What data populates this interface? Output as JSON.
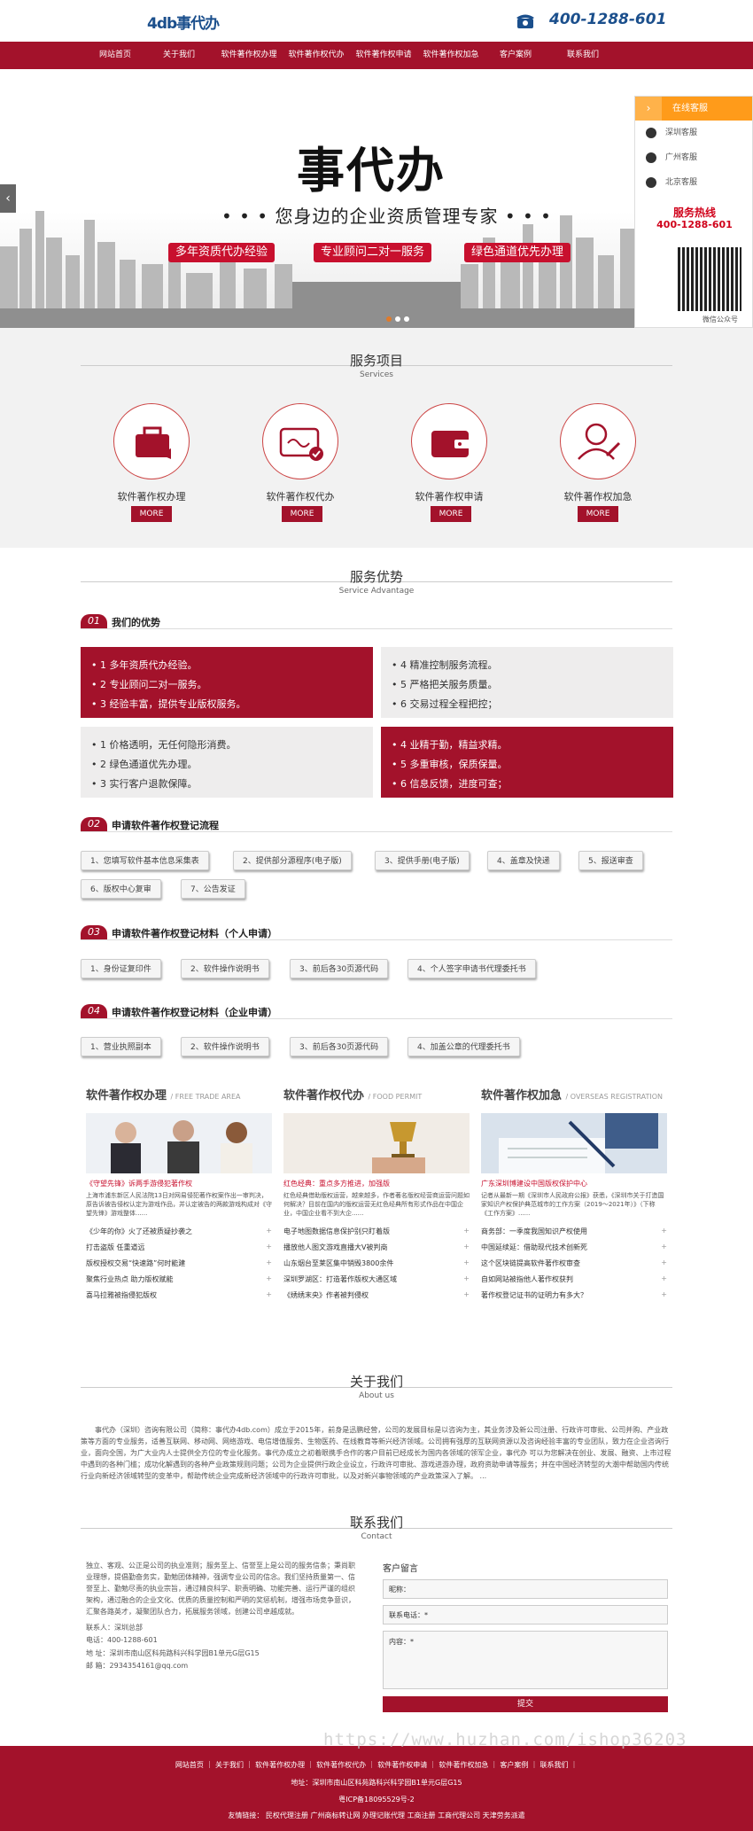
{
  "header": {
    "logo_mark": "4db",
    "logo_text": "事代办",
    "phone": "400-1288-601"
  },
  "nav": [
    "网站首页",
    "关于我们",
    "软件著作权办理",
    "软件著作权代办",
    "软件著作权申请",
    "软件著作权加急",
    "客户案例",
    "联系我们"
  ],
  "banner": {
    "brand": "事代办",
    "slogan": "• • •  您身边的企业资质管理专家  • • •",
    "tags": [
      "多年资质代办经验",
      "专业顾问二对一服务",
      "绿色通道优先办理"
    ]
  },
  "side": {
    "title": "在线客服",
    "items": [
      "深圳客服",
      "广州客服",
      "北京客服"
    ],
    "hotline_label": "服务热线",
    "hotline": "400-1288-601",
    "qr_caption": "微信公众号"
  },
  "services": {
    "title": "服务项目",
    "subtitle": "Services",
    "items": [
      {
        "label": "软件著作权办理"
      },
      {
        "label": "软件著作权代办"
      },
      {
        "label": "软件著作权申请"
      },
      {
        "label": "软件著作权加急"
      }
    ],
    "more": "MORE"
  },
  "advantage": {
    "title": "服务优势",
    "subtitle": "Service Advantage",
    "h1_num": "01",
    "h1": "我们的优势",
    "box1": [
      "• 1 多年资质代办经验。",
      "• 2 专业顾问二对一服务。",
      "• 3 经验丰富，提供专业版权服务。"
    ],
    "box2": [
      "• 4 精准控制服务流程。",
      "• 5 严格把关服务质量。",
      "• 6 交易过程全程把控；"
    ],
    "box3": [
      "• 1 价格透明，无任何隐形消费。",
      "• 2 绿色通道优先办理。",
      "• 3 实行客户退款保障。"
    ],
    "box4": [
      "• 4 业精于勤，精益求精。",
      "• 5 多重审核，保质保量。",
      "• 6 信息反馈，进度可查；"
    ],
    "h2_num": "02",
    "h2": "申请软件著作权登记流程",
    "steps": [
      "1、您填写软件基本信息采集表",
      "2、提供部分源程序(电子版)",
      "3、提供手册(电子版)",
      "4、盖章及快递",
      "5、报送审查",
      "6、版权中心复审",
      "7、公告发证"
    ],
    "h3_num": "03",
    "h3": "申请软件著作权登记材料（个人申请）",
    "personal": [
      "1、身份证复印件",
      "2、软件操作说明书",
      "3、前后各30页源代码",
      "4、个人签字申请书代理委托书"
    ],
    "h4_num": "04",
    "h4": "申请软件著作权登记材料（企业申请）",
    "company": [
      "1、营业执照副本",
      "2、软件操作说明书",
      "3、前后各30页源代码",
      "4、加盖公章的代理委托书"
    ]
  },
  "columns": [
    {
      "title": "软件著作权办理",
      "sub": "/ FREE TRADE AREA",
      "headline": "《守望先锋》诉两手游侵犯著作权",
      "summary": "上海市浦东新区人民法院13日对网易侵犯著作权案作出一审判决，原告诉被告侵权认定为游戏作品，并认定被告的两款游戏构成对《守望先锋》游戏整体......",
      "items": [
        "《少年的你》火了还被质疑抄袭之",
        "打击盗版 任重道远",
        "版权授权交易“快速路”何时能建",
        "聚焦行业热点 助力版权赋能",
        "喜马拉雅被指侵犯版权"
      ]
    },
    {
      "title": "软件著作权代办",
      "sub": "/ FOOD PERMIT",
      "headline": "红色经典：重点多方推进，加强版",
      "summary": "红色经典借助版权运营，越来越多，作者著名版权经营商运营问题如何解决？目前在国内的版权运营无红色经典所有形式作品在中国企业，中国企业看不到大企......",
      "items": [
        "电子地图数据信息保护别只盯着版",
        "播放他人图文游戏直播大V被判商",
        "山东烟台至莱区集中销毁3800余件",
        "深圳罗湖区：打造著作版权大通区域",
        "《绣绣末央》作者被判侵权"
      ]
    },
    {
      "title": "软件著作权加急",
      "sub": "/ OVERSEAS REGISTRATION",
      "headline": "广东深圳博建设中国版权保护中心",
      "summary": "记者从最新一期《深圳市人民政府公报》获悉，《深圳市关于打造国家知识产权保护典范城市的工作方案（2019～2021年）》（下称《工作方案》......",
      "items": [
        "商务部：一季度我国知识产权使用",
        "中国延续延：借助现代技术创新死",
        "这个区块链提高软件著作权审查",
        "自如网站被指他人著作权获判",
        "著作权登记证书的证明力有多大？"
      ]
    }
  ],
  "about": {
    "title": "关于我们",
    "subtitle": "About us",
    "text": "事代办（深圳）咨询有限公司（简称：事代办4db.com）成立于2015年，前身是迅鹏经营，公司的发展目标是以咨询为主，其业务涉及新公司注册、行政许可审批、公司并购、产业政策等方面的专业服务，适善互联网、移动网、网络游戏、电信增值服务、生物医药、在线教育等新兴经济领域。公司拥有强厚的互联网资源以及咨询经验丰富的专业团队，致力在企业咨询行业，面向全国，为广大业内人士提供全方位的专业化服务。事代办成立之初着眼携手合作的客户目前已经成长为国内各领域的领军企业，事代办 可以为您解决在创业、发展、融资、上市过程中遇到的各种门槛；成功化解遇到的各种产业政策规则问题；公司为企业提供行政企业设立，行政许可审批、游戏进游办理，政府资助申请等服务；并在中国经济转型的大潮中帮助国内传统行业向新经济领域转型的变革中，帮助传统企业完成新经济领域中的行政许可审批，以及对新兴事物领域的产业政策深入了解。 ..."
  },
  "contact": {
    "title": "联系我们",
    "subtitle": "Contact",
    "text": "独立、客观、公正是公司的执业准则；服务至上、信誉至上是公司的服务信条；秉尚职业理想，提倡勤奋务实，勤勉团体精神，强调专业公司的信念。我们坚持质量第一、信誉至上、勤勉尽责的执业宗旨，通过精良科学、职责明确、功能完善、运行严谨的组织架构，通过融合的企业文化、优质的质量控制和严明的奖惩机制，增强市场竞争意识，汇聚各路英才，凝聚团队合力，拓展服务领域，创建公司卓越成就。",
    "company": "联系人：深圳总部",
    "tel": "电话：400-1288-601",
    "addr": "地 址：深圳市南山区科苑路科兴科学园B1单元G层G15",
    "mail": "邮 箱：2934354161@qq.com",
    "form_title": "客户留言",
    "name_label": "昵称：",
    "phone_label": "联系电话：*",
    "content_label": "内容：*",
    "submit": "提交"
  },
  "footer": {
    "links": "网站首页 ｜ 关于我们 ｜ 软件著作权办理 ｜ 软件著作权代办 ｜ 软件著作权申请 ｜ 软件著作权加急 ｜ 客户案例 ｜ 联系我们 ｜",
    "address": "地址：深圳市南山区科苑路科兴科学园B1单元G层G15",
    "icp": "粤ICP备18095529号-2",
    "friends": "友情链接： 民权代理注册 广州商标转让网 办理记账代理 工商注册 工商代理公司 天津劳务派遣"
  },
  "watermark": "https://www.huzhan.com/ishop36203"
}
